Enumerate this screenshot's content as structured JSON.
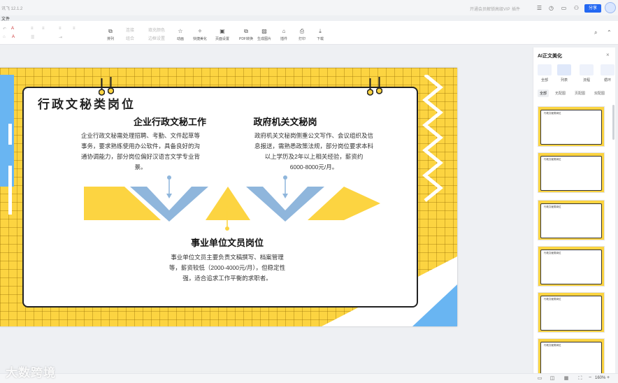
{
  "window": {
    "title": "讯飞 12.1.2",
    "menu": "文件",
    "vip_text": "开通会员解锁高级VIP",
    "extensions": "插件"
  },
  "header_right": {
    "share_label": "分享"
  },
  "ribbon": {
    "tools": [
      {
        "label": "排列",
        "icon": "arrange-icon"
      },
      {
        "label": "动画",
        "icon": "star-icon"
      },
      {
        "label": "快捷美化",
        "icon": "magic-wand-icon"
      },
      {
        "label": "页面设置",
        "icon": "page-setup-icon"
      },
      {
        "label": "PDF转换",
        "icon": "pdf-icon"
      },
      {
        "label": "生成图片",
        "icon": "image-icon"
      },
      {
        "label": "插件",
        "icon": "plugin-icon"
      },
      {
        "label": "打印",
        "icon": "printer-icon"
      },
      {
        "label": "下载",
        "icon": "download-icon"
      }
    ],
    "small_labels": [
      "连接",
      "填充颜色",
      "组合",
      "边框设置"
    ]
  },
  "slide": {
    "title": "行政文秘类岗位",
    "sections": [
      {
        "title": "企业行政文秘工作",
        "body": [
          "企业行政文秘需处理招聘、考勤、文件起草等",
          "事务，要求熟练使用办公软件，具备良好的沟",
          "通协调能力，部分岗位偏好汉语言文学专业背",
          "景。"
        ]
      },
      {
        "title": "政府机关文秘岗",
        "body": [
          "政府机关文秘岗侧重公文写作、会议组织及信",
          "息报送，需熟悉政策法规，部分岗位要求本科",
          "以上学历及2年以上相关经验，薪资约",
          "6000-8000元/月。"
        ]
      },
      {
        "title": "事业单位文员岗位",
        "body": [
          "事业单位文员主要负责文稿撰写、档案管理",
          "等，薪资较低（2000-4000元/月），但稳定性",
          "强，适合追求工作平衡的求职者。"
        ]
      }
    ],
    "colors": {
      "yellow": "#fcd441",
      "blue": "#69b5f2",
      "arrow_blue": "#8fb6dc",
      "dark": "#222222"
    }
  },
  "panel": {
    "title": "AI正文美化",
    "categories": [
      {
        "label": "全部"
      },
      {
        "label": "列表"
      },
      {
        "label": "流程"
      },
      {
        "label": "循环"
      }
    ],
    "subtabs": [
      "全部",
      "无配图",
      "页配图",
      "双配图"
    ],
    "templates": [
      {
        "title": "行政文秘类岗位"
      },
      {
        "title": "行政文秘类岗位"
      },
      {
        "title": "行政文秘类岗位"
      },
      {
        "title": "行政文秘类岗位"
      },
      {
        "title": "行政文秘类岗位"
      },
      {
        "title": "行政文秘类岗位"
      }
    ]
  },
  "status": {
    "zoom": "160%",
    "zoom_minus": "−",
    "zoom_plus": "+"
  },
  "watermark": "大数跨境"
}
